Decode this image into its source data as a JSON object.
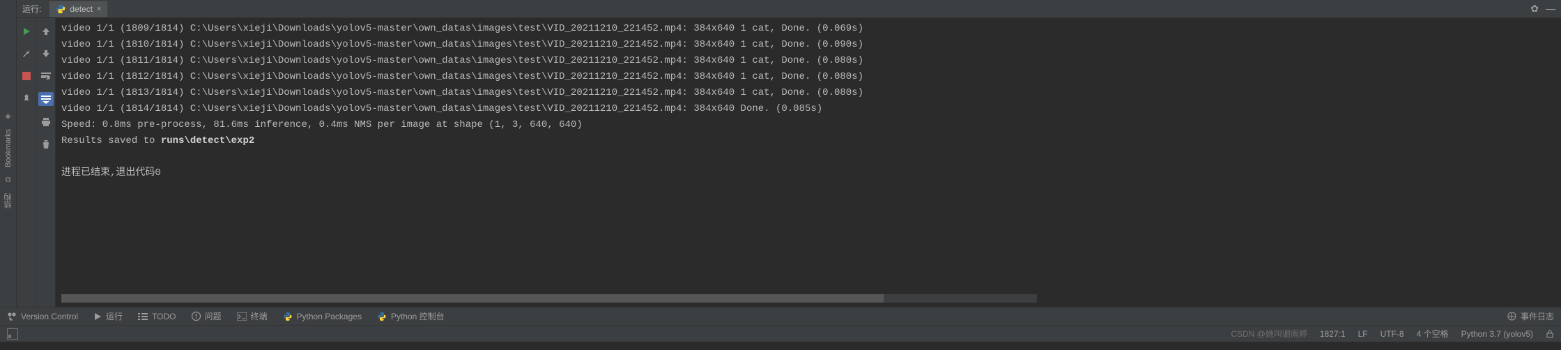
{
  "header": {
    "run_label": "运行:",
    "tab_label": "detect",
    "gear_title": "settings",
    "minimize_title": "minimize"
  },
  "gutter_a": {
    "rerun": "Rerun",
    "stop": "Stop",
    "wrench": "Modify"
  },
  "gutter_b": {
    "up": "Up",
    "down": "Down",
    "wrap": "Soft-Wrap",
    "scroll": "Scroll to End",
    "print": "Print",
    "trash": "Clear"
  },
  "left_stripe": {
    "bookmarks": "Bookmarks",
    "structure": "结构"
  },
  "console": {
    "lines": [
      "video 1/1 (1809/1814) C:\\Users\\xieji\\Downloads\\yolov5-master\\own_datas\\images\\test\\VID_20211210_221452.mp4: 384x640 1 cat, Done. (0.069s)",
      "video 1/1 (1810/1814) C:\\Users\\xieji\\Downloads\\yolov5-master\\own_datas\\images\\test\\VID_20211210_221452.mp4: 384x640 1 cat, Done. (0.090s)",
      "video 1/1 (1811/1814) C:\\Users\\xieji\\Downloads\\yolov5-master\\own_datas\\images\\test\\VID_20211210_221452.mp4: 384x640 1 cat, Done. (0.080s)",
      "video 1/1 (1812/1814) C:\\Users\\xieji\\Downloads\\yolov5-master\\own_datas\\images\\test\\VID_20211210_221452.mp4: 384x640 1 cat, Done. (0.080s)",
      "video 1/1 (1813/1814) C:\\Users\\xieji\\Downloads\\yolov5-master\\own_datas\\images\\test\\VID_20211210_221452.mp4: 384x640 1 cat, Done. (0.080s)",
      "video 1/1 (1814/1814) C:\\Users\\xieji\\Downloads\\yolov5-master\\own_datas\\images\\test\\VID_20211210_221452.mp4: 384x640 Done. (0.085s)",
      "Speed: 0.8ms pre-process, 81.6ms inference, 0.4ms NMS per image at shape (1, 3, 640, 640)"
    ],
    "results_prefix": "Results saved to ",
    "results_path": "runs\\detect\\exp2",
    "exit_line": "进程已结束,退出代码0"
  },
  "toolbar": {
    "version_control": "Version Control",
    "run": "运行",
    "todo": "TODO",
    "problems": "问题",
    "terminal": "终端",
    "python_packages": "Python Packages",
    "python_console": "Python 控制台",
    "event_log": "事件日志"
  },
  "status": {
    "position": "1827:1",
    "line_sep": "LF",
    "encoding": "UTF-8",
    "indent": "4 个空格",
    "interpreter": "Python 3.7 (yolov5)",
    "watermark": "CSDN @她叫谢雨婷"
  }
}
